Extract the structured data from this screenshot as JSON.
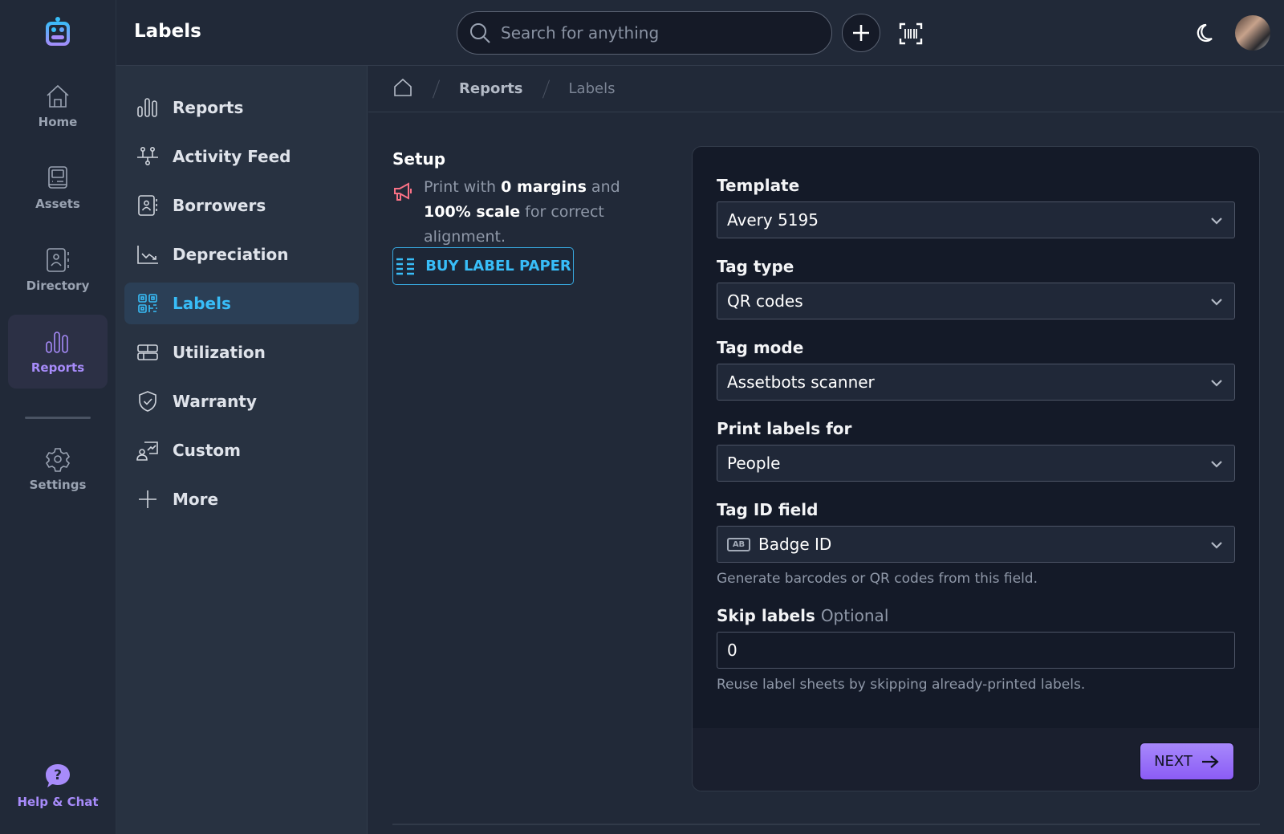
{
  "app": {
    "page_title": "Labels",
    "accent_color": "#a78bfa",
    "link_color": "#38bdf8"
  },
  "rail": {
    "items": [
      {
        "label": "Home",
        "icon": "home-icon"
      },
      {
        "label": "Assets",
        "icon": "assets-icon"
      },
      {
        "label": "Directory",
        "icon": "directory-icon"
      },
      {
        "label": "Reports",
        "icon": "reports-icon",
        "active": true
      },
      {
        "label": "Settings",
        "icon": "gear-icon"
      }
    ],
    "help_label": "Help & Chat"
  },
  "topbar": {
    "search_placeholder": "Search for anything"
  },
  "subnav": {
    "items": [
      {
        "label": "Reports",
        "icon": "bar-chart-icon"
      },
      {
        "label": "Activity Feed",
        "icon": "activity-feed-icon"
      },
      {
        "label": "Borrowers",
        "icon": "borrowers-icon"
      },
      {
        "label": "Depreciation",
        "icon": "depreciation-icon"
      },
      {
        "label": "Labels",
        "icon": "qr-code-icon",
        "active": true
      },
      {
        "label": "Utilization",
        "icon": "utilization-icon"
      },
      {
        "label": "Warranty",
        "icon": "shield-check-icon"
      },
      {
        "label": "Custom",
        "icon": "custom-report-icon"
      },
      {
        "label": "More",
        "icon": "plus-icon"
      }
    ]
  },
  "breadcrumb": {
    "items": [
      "Reports",
      "Labels"
    ]
  },
  "setup": {
    "title": "Setup",
    "note_parts": [
      "Print with ",
      "0 margins",
      " and ",
      "100% scale",
      " for correct alignment."
    ],
    "buy_button": "BUY LABEL PAPER"
  },
  "form": {
    "fields": [
      {
        "label": "Template",
        "value": "Avery 5195"
      },
      {
        "label": "Tag type",
        "value": "QR codes"
      },
      {
        "label": "Tag mode",
        "value": "Assetbots scanner"
      },
      {
        "label": "Print labels for",
        "value": "People"
      },
      {
        "label": "Tag ID field",
        "value": "Badge ID",
        "badge": "AB",
        "help": "Generate barcodes or QR codes from this field."
      }
    ],
    "skip": {
      "label": "Skip labels",
      "optional": "Optional",
      "value": "0",
      "help": "Reuse label sheets by skipping already-printed labels."
    },
    "next_button": "NEXT"
  }
}
